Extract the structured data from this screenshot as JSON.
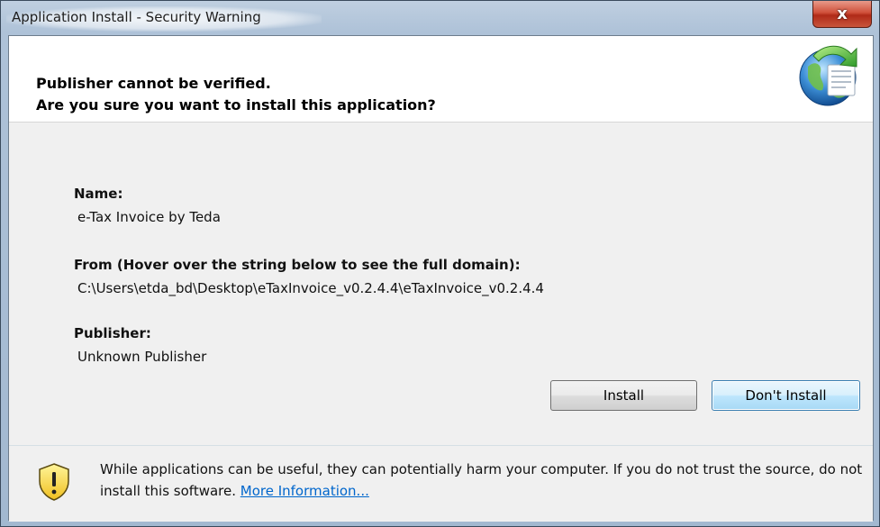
{
  "window": {
    "title": "Application Install - Security Warning",
    "close_glyph": "x",
    "close_icon": "close-icon"
  },
  "header": {
    "line1": "Publisher cannot be verified.",
    "line2": "Are you sure you want to install this application?",
    "icon": "application-install-icon"
  },
  "details": {
    "name_label": "Name:",
    "name_value": "e-Tax Invoice by Teda",
    "from_label": "From (Hover over the string below to see the full domain):",
    "from_value": "C:\\Users\\etda_bd\\Desktop\\eTaxInvoice_v0.2.4.4\\eTaxInvoice_v0.2.4.4",
    "publisher_label": "Publisher:",
    "publisher_value": "Unknown Publisher"
  },
  "buttons": {
    "install": "Install",
    "dont_install": "Don't Install"
  },
  "footer": {
    "icon": "warning-shield-icon",
    "warning_text": "While applications can be useful, they can potentially harm your computer. If you do not trust the source, do not install this software. ",
    "more_info_link": "More Information..."
  },
  "colors": {
    "link": "#0066cc",
    "close_button": "#c8553c",
    "default_button_border": "#3c7fb1"
  }
}
